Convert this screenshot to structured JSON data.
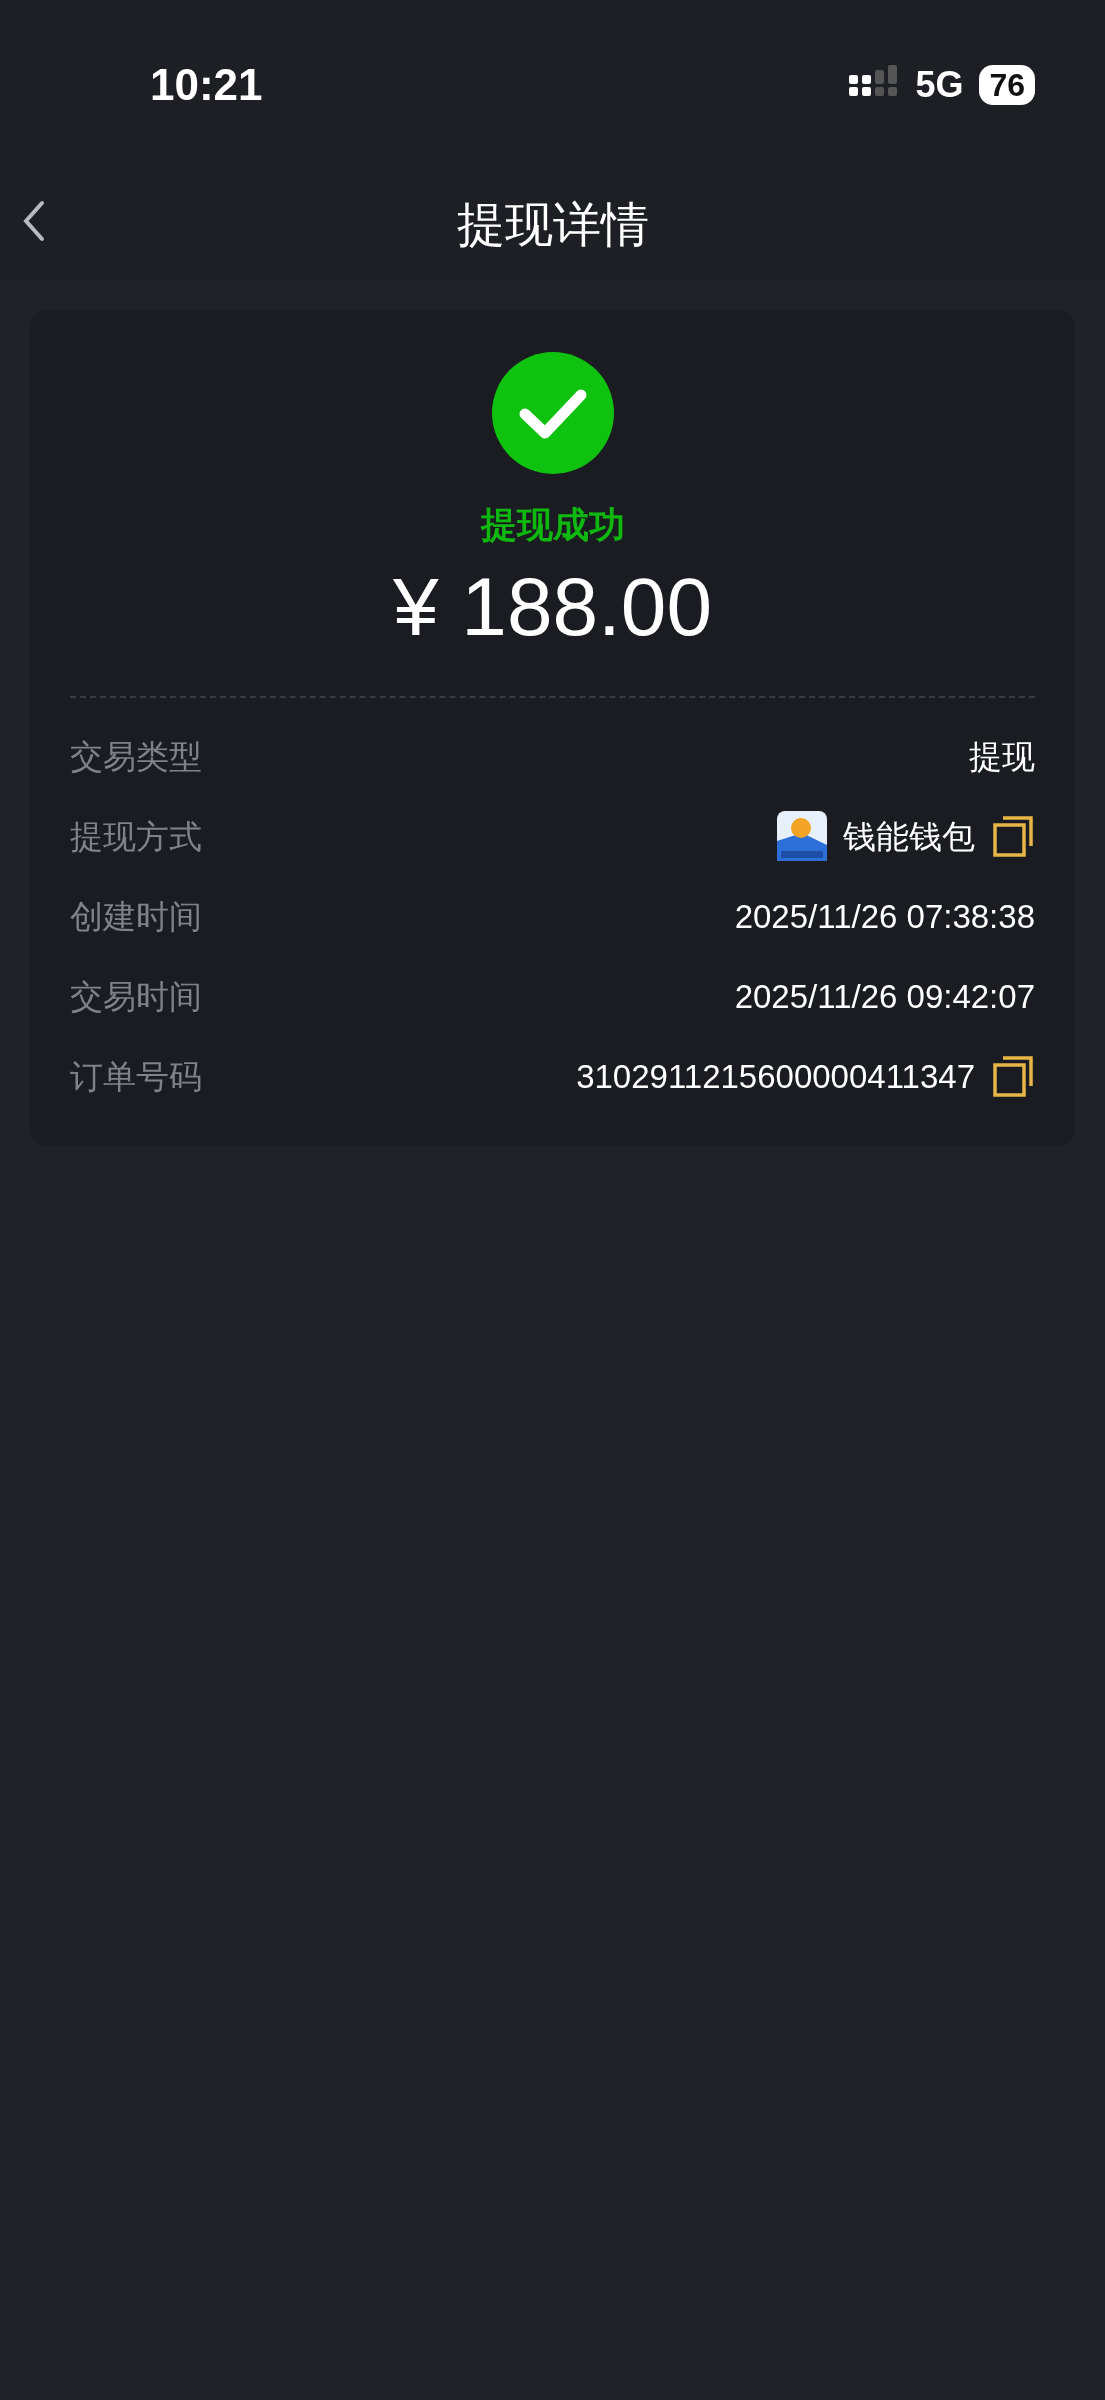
{
  "status_bar": {
    "time": "10:21",
    "network": "5G",
    "battery": "76"
  },
  "nav": {
    "title": "提现详情"
  },
  "result": {
    "status": "提现成功",
    "success": true,
    "amount": "¥ 188.00"
  },
  "details": [
    {
      "label": "交易类型",
      "value": "提现",
      "kind": "text",
      "copyable": false
    },
    {
      "label": "提现方式",
      "value": "钱能钱包",
      "kind": "app",
      "copyable": true
    },
    {
      "label": "创建时间",
      "value": "2025/11/26 07:38:38",
      "kind": "text",
      "copyable": false
    },
    {
      "label": "交易时间",
      "value": "2025/11/26 09:42:07",
      "kind": "text",
      "copyable": false
    },
    {
      "label": "订单号码",
      "value": "3102911215600000411347",
      "kind": "text",
      "copyable": true
    }
  ]
}
